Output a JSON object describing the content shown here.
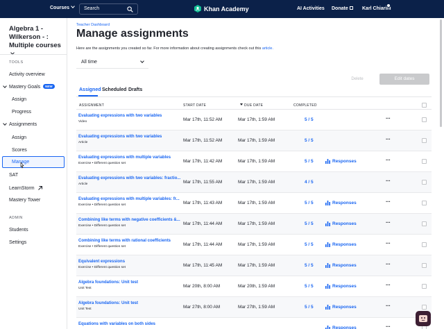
{
  "topbar": {
    "courses_label": "Courses",
    "search_label": "Search",
    "brand": "Khan Academy",
    "ai_activities": "AI Activities",
    "donate": "Donate",
    "user_name": "Karl Chiarini"
  },
  "sidebar": {
    "course_title": "Algebra 1 - Wilkerson - : Multiple courses",
    "tools_heading": "TOOLS",
    "activity_overview": "Activity overview",
    "mastery_goals": "Mastery Goals",
    "new_badge": "NEW",
    "assign": "Assign",
    "progress": "Progress",
    "assignments": "Assignments",
    "assign2": "Assign",
    "scores": "Scores",
    "manage": "Manage",
    "sat": "SAT",
    "learnstorm": "LearnStorm",
    "mastery_tower": "Mastery Tower",
    "admin_heading": "ADMIN",
    "students": "Students",
    "settings": "Settings"
  },
  "main": {
    "breadcrumb": "Teacher Dashboard",
    "title": "Manage assignments",
    "intro": "Here are the assignments you created so far. For more information about creating assignments check out this",
    "intro_link": "article.",
    "time_filter": "All time",
    "tabs": [
      "Assigned",
      "Scheduled",
      "Drafts"
    ],
    "delete_label": "Delete",
    "edit_dates_label": "Edit dates"
  },
  "table": {
    "headers": {
      "assignment": "ASSIGNMENT",
      "start_date": "START DATE",
      "due_date": "DUE DATE",
      "completed": "COMPLETED"
    },
    "rows": [
      {
        "title": "Evaluating expressions with two variables",
        "type": "Video",
        "start": "Mar 17th, 11:52 AM",
        "due": "Mar 17th, 1:59 AM",
        "completed": "5 / 5",
        "responses": ""
      },
      {
        "title": "Evaluating expressions with two variables",
        "type": "Article",
        "start": "Mar 17th, 11:52 AM",
        "due": "Mar 17th, 1:59 AM",
        "completed": "5 / 5",
        "responses": ""
      },
      {
        "title": "Evaluating expressions with multiple variables",
        "type": "Exercise • Different question set",
        "start": "Mar 17th, 11:42 AM",
        "due": "Mar 17th, 1:59 AM",
        "completed": "5 / 5",
        "responses": "Responses"
      },
      {
        "title": "Evaluating expressions with two variables: fractio...",
        "type": "Article",
        "start": "Mar 17th, 11:55 AM",
        "due": "Mar 17th, 1:59 AM",
        "completed": "4 / 5",
        "responses": ""
      },
      {
        "title": "Evaluating expressions with multiple variables: fr...",
        "type": "Exercise • Different question set",
        "start": "Mar 17th, 11:43 AM",
        "due": "Mar 17th, 1:59 AM",
        "completed": "5 / 5",
        "responses": "Responses"
      },
      {
        "title": "Combining like terms with negative coefficients &...",
        "type": "Exercise • Different question set",
        "start": "Mar 17th, 11:44 AM",
        "due": "Mar 17th, 1:59 AM",
        "completed": "5 / 5",
        "responses": "Responses"
      },
      {
        "title": "Combining like terms with rational coefficients",
        "type": "Exercise • Different question set",
        "start": "Mar 17th, 11:44 AM",
        "due": "Mar 17th, 1:59 AM",
        "completed": "5 / 5",
        "responses": "Responses"
      },
      {
        "title": "Equivalent expressions",
        "type": "Exercise • Different question set",
        "start": "Mar 17th, 11:45 AM",
        "due": "Mar 17th, 1:59 AM",
        "completed": "5 / 5",
        "responses": "Responses"
      },
      {
        "title": "Algebra foundations: Unit test",
        "type": "Unit Test",
        "start": "Mar 20th, 8:00 AM",
        "due": "Mar 20th, 1:59 AM",
        "completed": "5 / 5",
        "responses": "Responses"
      },
      {
        "title": "Algebra foundations: Unit test",
        "type": "Unit Test",
        "start": "Mar 27th, 8:00 AM",
        "due": "Mar 27th, 1:59 AM",
        "completed": "5 / 5",
        "responses": "Responses"
      },
      {
        "title": "Equations with variables on both sides",
        "type": "",
        "start": "",
        "due": "",
        "completed": "",
        "responses": "Responses"
      }
    ]
  },
  "colors": {
    "nav_bg": "#0b2149",
    "accent": "#1865f2"
  }
}
